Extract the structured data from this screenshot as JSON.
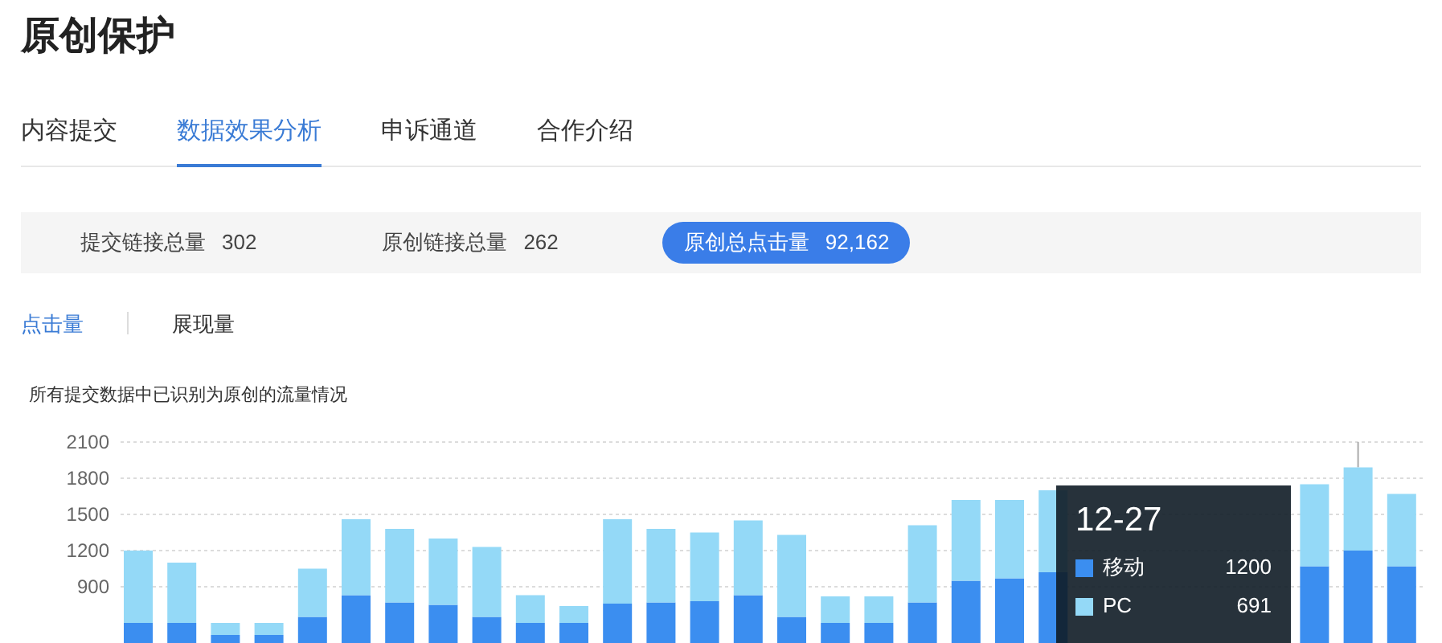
{
  "page_title": "原创保护",
  "tabs": [
    {
      "label": "内容提交",
      "selected": false
    },
    {
      "label": "数据效果分析",
      "selected": true
    },
    {
      "label": "申诉通道",
      "selected": false
    },
    {
      "label": "合作介绍",
      "selected": false
    }
  ],
  "stats": [
    {
      "label": "提交链接总量",
      "value": "302",
      "selected": false
    },
    {
      "label": "原创链接总量",
      "value": "262",
      "selected": false
    },
    {
      "label": "原创总点击量",
      "value": "92,162",
      "selected": true
    }
  ],
  "metric_tabs": [
    {
      "label": "点击量",
      "selected": true
    },
    {
      "label": "展现量",
      "selected": false
    }
  ],
  "chart": {
    "caption": "所有提交数据中已识别为原创的流量情况",
    "chart_data": {
      "type": "bar",
      "stacked": true,
      "grid": true,
      "yticks": [
        900,
        1200,
        1500,
        1800,
        2100
      ],
      "ylim": [
        0,
        2100
      ],
      "series": [
        {
          "name": "移动",
          "color": "#3b8ef0",
          "values": [
            600,
            600,
            500,
            500,
            650,
            830,
            770,
            750,
            650,
            600,
            600,
            760,
            770,
            780,
            830,
            650,
            600,
            600,
            770,
            950,
            970,
            1020,
            null,
            null,
            null,
            null,
            null,
            1070,
            1200,
            1070
          ]
        },
        {
          "name": "PC",
          "color": "#94d9f7",
          "values": [
            600,
            500,
            100,
            100,
            400,
            630,
            610,
            550,
            580,
            230,
            140,
            700,
            610,
            570,
            620,
            680,
            220,
            220,
            640,
            670,
            650,
            680,
            null,
            null,
            null,
            null,
            null,
            680,
            690,
            600
          ]
        }
      ]
    },
    "tooltip": {
      "title": "12-27",
      "values": [
        "1200",
        "691"
      ]
    }
  }
}
